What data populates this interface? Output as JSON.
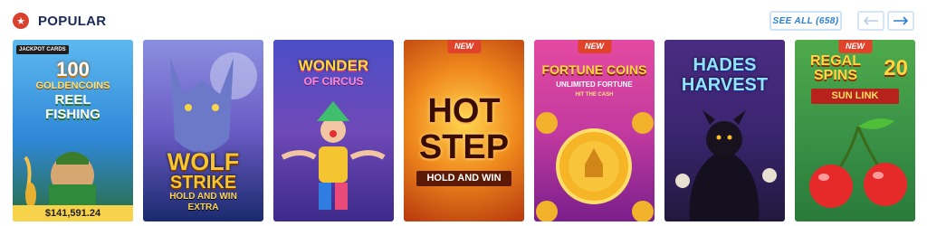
{
  "section": {
    "title": "POPULAR",
    "see_all_label": "SEE ALL (658)",
    "icon": "star-badge-icon",
    "accent": "#d9412e"
  },
  "nav": {
    "prev_icon": "arrow-left-icon",
    "next_icon": "arrow-right-icon"
  },
  "games": [
    {
      "art_lines": [
        "JACKPOT CARDS",
        "100",
        "GOLDENCOINS",
        "REEL",
        "FISHING"
      ],
      "jackpot": "$141,591.24",
      "badge": ""
    },
    {
      "art_lines": [
        "WOLF",
        "STRIKE",
        "HOLD AND WIN",
        "EXTRA"
      ],
      "badge": ""
    },
    {
      "art_lines": [
        "WONDER",
        "OF CIRCUS"
      ],
      "badge": ""
    },
    {
      "art_lines": [
        "HOT",
        "STEP",
        "HOLD AND WIN"
      ],
      "badge": "NEW"
    },
    {
      "art_lines": [
        "FORTUNE COINS",
        "UNLIMITED FORTUNE",
        "HIT THE CASH"
      ],
      "badge": "NEW"
    },
    {
      "art_lines": [
        "HADES",
        "HARVEST"
      ],
      "badge": ""
    },
    {
      "art_lines": [
        "REGAL",
        "SPINS",
        "20",
        "SUN LINK"
      ],
      "badge": "NEW"
    }
  ]
}
